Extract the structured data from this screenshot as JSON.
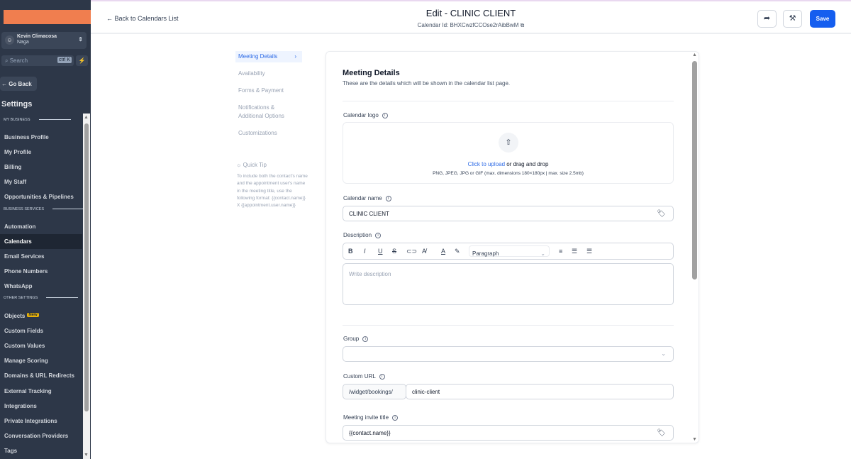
{
  "sidebar": {
    "user_name": "Kevin Climacosa",
    "user_location": "Naga",
    "search_placeholder": "Search",
    "search_shortcut": "ctrl K",
    "go_back": "← Go Back",
    "settings_title": "Settings",
    "sections": [
      "MY BUSINESS",
      "BUSINESS SERVICES",
      "OTHER SETTINGS"
    ],
    "items": [
      "Business Profile",
      "My Profile",
      "Billing",
      "My Staff",
      "Opportunities & Pipelines",
      "Automation",
      "Calendars",
      "Email Services",
      "Phone Numbers",
      "WhatsApp",
      "Objects",
      "Custom Fields",
      "Custom Values",
      "Manage Scoring",
      "Domains & URL Redirects",
      "External Tracking",
      "Integrations",
      "Private Integrations",
      "Conversation Providers",
      "Tags"
    ],
    "new_badge": "New",
    "active": "Calendars"
  },
  "header": {
    "back": "← Back to Calendars List",
    "title": "Edit - CLINIC CLIENT",
    "calendar_id": "Calendar Id: BHXCwzfCCOse2rAibBwM",
    "save": "Save"
  },
  "nav": {
    "items": [
      "Meeting Details",
      "Availability",
      "Forms & Payment",
      "Notifications & Additional Options",
      "Customizations"
    ],
    "active": "Meeting Details"
  },
  "tip": {
    "title": "Quick Tip",
    "text": "To include both the contact's name and the appointment user's name in the meeting title, use the following format: {{contact.name}} X {{appointment.user.name}}"
  },
  "form": {
    "heading": "Meeting Details",
    "subheading": "These are the details which will be shown in the calendar list page.",
    "logo_label": "Calendar logo",
    "upload_link": "Click to upload",
    "upload_rest": " or drag and drop",
    "upload_hint": "PNG, JPEG, JPG or GIF (max. dimensions 180×180px | max. size 2.5mb)",
    "name_label": "Calendar name",
    "name_value": "CLINIC CLIENT",
    "desc_label": "Description",
    "paragraph": "Paragraph",
    "desc_placeholder": "Write description",
    "group_label": "Group",
    "group_value": "",
    "url_label": "Custom URL",
    "url_prefix": "/widget/bookings/",
    "url_value": "clinic-client",
    "invite_label": "Meeting invite title",
    "invite_value": "{{contact.name}}"
  }
}
